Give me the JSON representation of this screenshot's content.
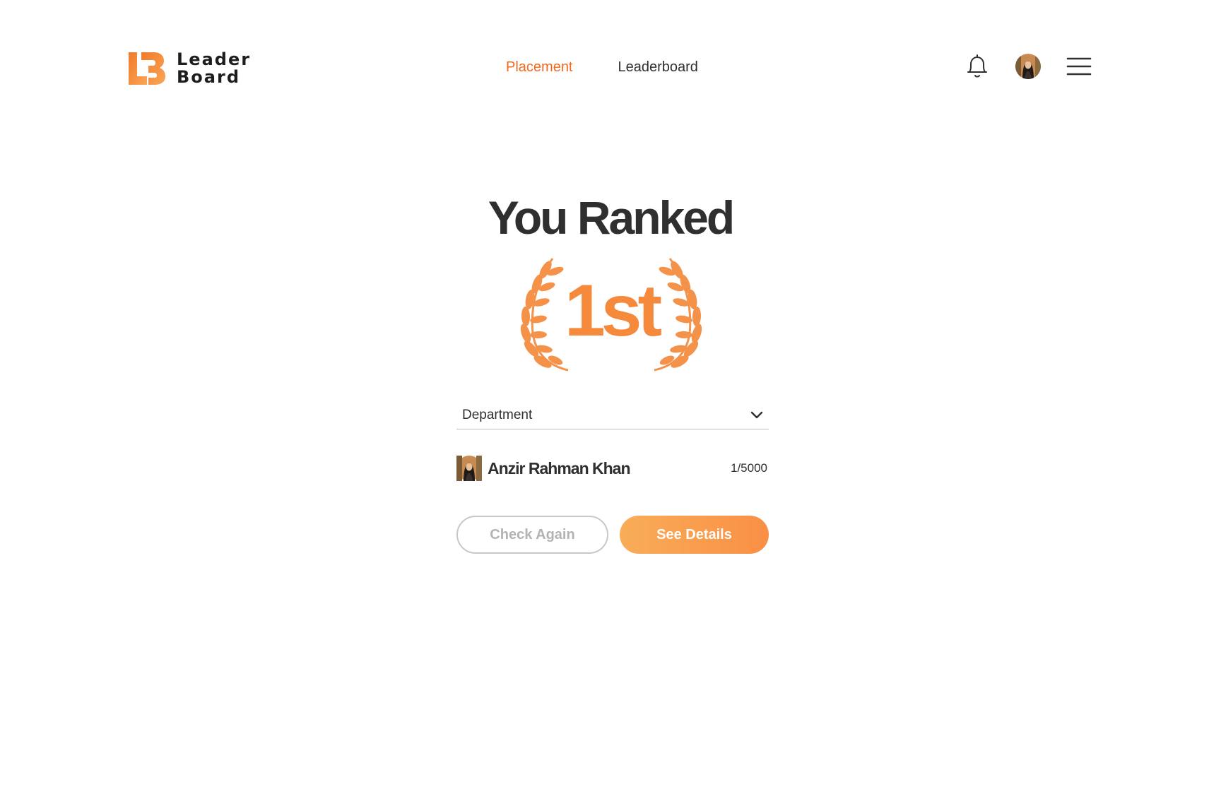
{
  "brand": {
    "line1": "Leader",
    "line2": "Board",
    "accent_color": "#f58a3c"
  },
  "nav": {
    "items": [
      {
        "label": "Placement",
        "active": true
      },
      {
        "label": "Leaderboard",
        "active": false
      }
    ]
  },
  "header_icons": [
    "bell-icon",
    "avatar",
    "menu-icon"
  ],
  "hero": {
    "title": "You Ranked",
    "rank": "1st"
  },
  "department_select": {
    "label": "Department"
  },
  "result": {
    "name": "Anzir Rahman Khan",
    "score": "1/5000"
  },
  "actions": {
    "secondary_label": "Check Again",
    "primary_label": "See Details"
  }
}
